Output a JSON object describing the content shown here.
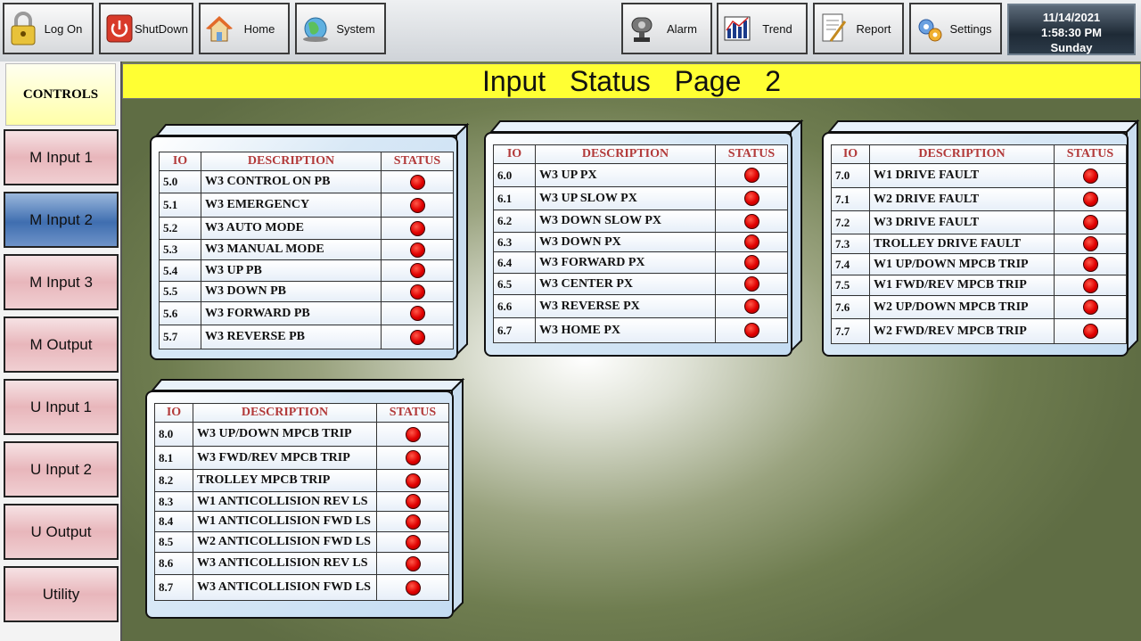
{
  "toolbar": {
    "log_on": "Log On",
    "shutdown": "ShutDown",
    "home": "Home",
    "system": "System",
    "alarm": "Alarm",
    "trend": "Trend",
    "report": "Report",
    "settings": "Settings"
  },
  "datetime": {
    "date": "11/14/2021",
    "time": "1:58:30 PM",
    "day": "Sunday"
  },
  "sidebar": {
    "title": "CONTROLS",
    "items": [
      {
        "label": "M Input 1",
        "active": false
      },
      {
        "label": "M Input 2",
        "active": true
      },
      {
        "label": "M Input 3",
        "active": false
      },
      {
        "label": "M Output",
        "active": false
      },
      {
        "label": "U Input 1",
        "active": false
      },
      {
        "label": "U Input 2",
        "active": false
      },
      {
        "label": "U Output",
        "active": false
      },
      {
        "label": "Utility",
        "active": false
      }
    ]
  },
  "page_title": "Input Status Page 2",
  "colors": {
    "title_bar": "#ffff33",
    "status_led": "#e00000",
    "header_text": "#b23a3a",
    "active_nav": "#3f6eb0"
  },
  "panels": [
    {
      "headers": {
        "io": "IO",
        "description": "DESCRIPTION",
        "status": "STATUS"
      },
      "rows": [
        {
          "io": "5.0",
          "description": "W3 CONTROL ON PB",
          "status": "red"
        },
        {
          "io": "5.1",
          "description": "W3 EMERGENCY",
          "status": "red"
        },
        {
          "io": "5.2",
          "description": "W3 AUTO MODE",
          "status": "red"
        },
        {
          "io": "5.3",
          "description": "W3 MANUAL MODE",
          "status": "red"
        },
        {
          "io": "5.4",
          "description": "W3 UP PB",
          "status": "red"
        },
        {
          "io": "5.5",
          "description": "W3 DOWN PB",
          "status": "red"
        },
        {
          "io": "5.6",
          "description": "W3 FORWARD PB",
          "status": "red"
        },
        {
          "io": "5.7",
          "description": "W3 REVERSE PB",
          "status": "red"
        }
      ]
    },
    {
      "headers": {
        "io": "IO",
        "description": "DESCRIPTION",
        "status": "STATUS"
      },
      "rows": [
        {
          "io": "6.0",
          "description": "W3 UP PX",
          "status": "red"
        },
        {
          "io": "6.1",
          "description": "W3 UP SLOW PX",
          "status": "red"
        },
        {
          "io": "6.2",
          "description": "W3 DOWN SLOW PX",
          "status": "red"
        },
        {
          "io": "6.3",
          "description": "W3 DOWN PX",
          "status": "red"
        },
        {
          "io": "6.4",
          "description": "W3 FORWARD PX",
          "status": "red"
        },
        {
          "io": "6.5",
          "description": "W3 CENTER PX",
          "status": "red"
        },
        {
          "io": "6.6",
          "description": "W3 REVERSE PX",
          "status": "red"
        },
        {
          "io": "6.7",
          "description": "W3 HOME PX",
          "status": "red"
        }
      ]
    },
    {
      "headers": {
        "io": "IO",
        "description": "DESCRIPTION",
        "status": "STATUS"
      },
      "rows": [
        {
          "io": "7.0",
          "description": "W1 DRIVE FAULT",
          "status": "red"
        },
        {
          "io": "7.1",
          "description": "W2 DRIVE FAULT",
          "status": "red"
        },
        {
          "io": "7.2",
          "description": "W3 DRIVE FAULT",
          "status": "red"
        },
        {
          "io": "7.3",
          "description": "TROLLEY DRIVE FAULT",
          "status": "red"
        },
        {
          "io": "7.4",
          "description": "W1 UP/DOWN MPCB TRIP",
          "status": "red"
        },
        {
          "io": "7.5",
          "description": "W1 FWD/REV MPCB TRIP",
          "status": "red"
        },
        {
          "io": "7.6",
          "description": "W2 UP/DOWN MPCB TRIP",
          "status": "red"
        },
        {
          "io": "7.7",
          "description": "W2 FWD/REV MPCB TRIP",
          "status": "red"
        }
      ]
    },
    {
      "headers": {
        "io": "IO",
        "description": "DESCRIPTION",
        "status": "STATUS"
      },
      "rows": [
        {
          "io": "8.0",
          "description": "W3 UP/DOWN MPCB TRIP",
          "status": "red"
        },
        {
          "io": "8.1",
          "description": "W3 FWD/REV MPCB TRIP",
          "status": "red"
        },
        {
          "io": "8.2",
          "description": "TROLLEY MPCB TRIP",
          "status": "red"
        },
        {
          "io": "8.3",
          "description": "W1 ANTICOLLISION REV LS",
          "status": "red"
        },
        {
          "io": "8.4",
          "description": "W1 ANTICOLLISION FWD LS",
          "status": "red"
        },
        {
          "io": "8.5",
          "description": "W2 ANTICOLLISION FWD LS",
          "status": "red"
        },
        {
          "io": "8.6",
          "description": "W3 ANTICOLLISION REV LS",
          "status": "red"
        },
        {
          "io": "8.7",
          "description": "W3 ANTICOLLISION FWD LS",
          "status": "red"
        }
      ]
    }
  ]
}
